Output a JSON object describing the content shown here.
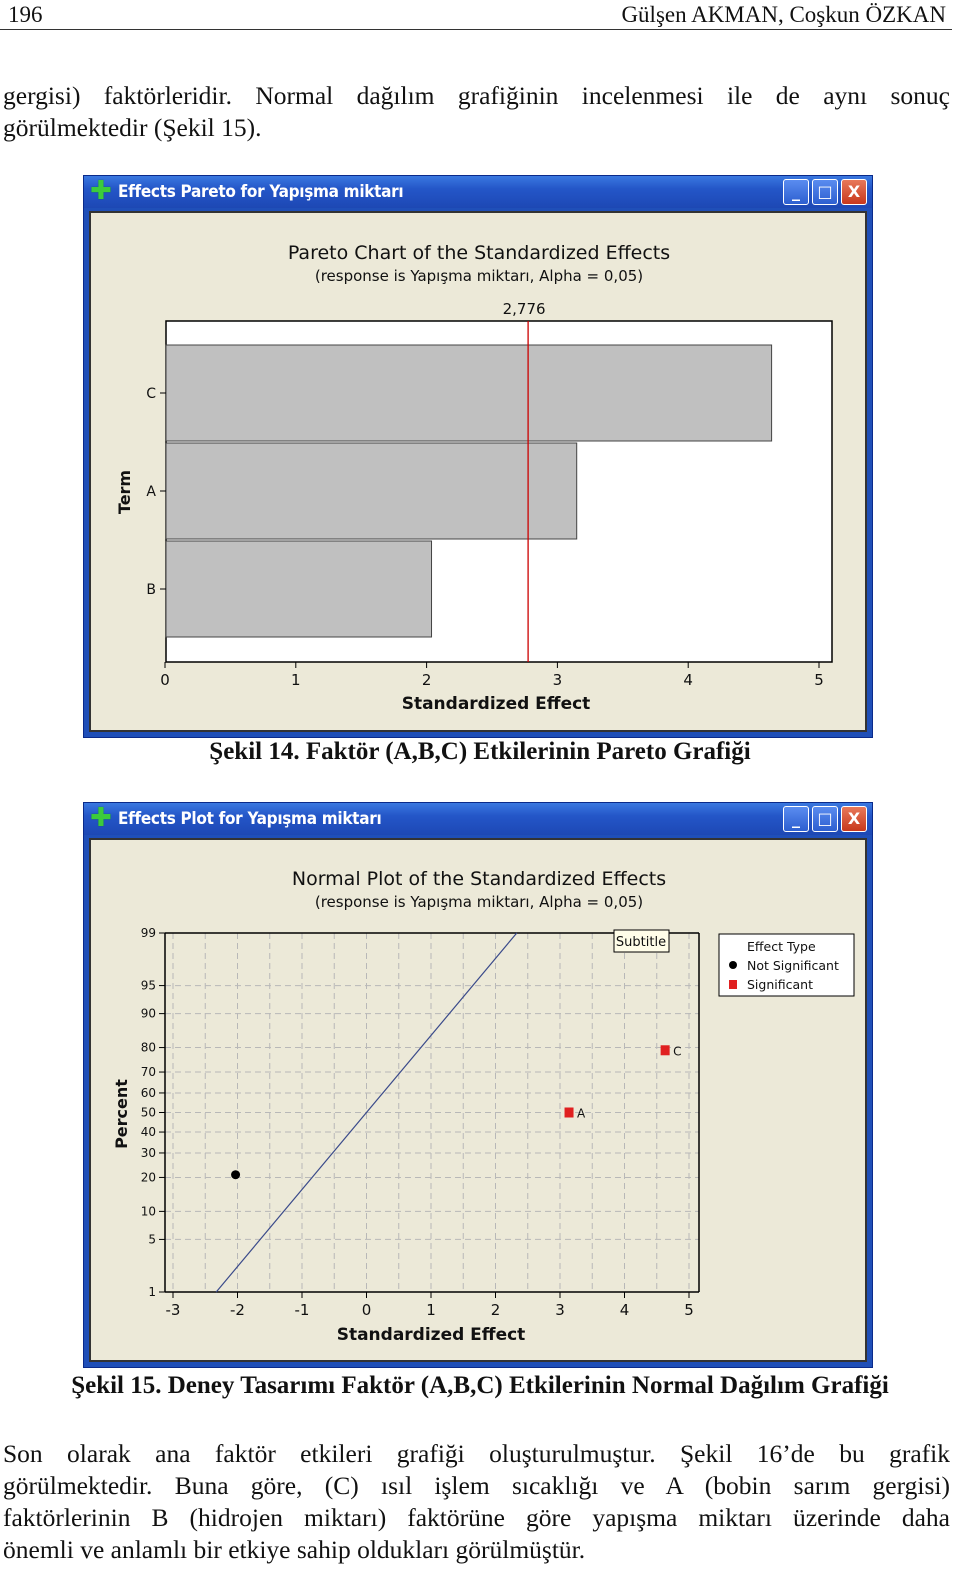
{
  "header": {
    "page_number": "196",
    "authors": "Gülşen AKMAN, Coşkun ÖZKAN"
  },
  "intro_paragraph": [
    "gergisi) faktörleridir. Normal dağılım grafiğinin incelenmesi ile de aynı sonuç",
    "görülmektedir (Şekil 15)."
  ],
  "figure14": {
    "window_title": "Effects Pareto for Yapışma miktarı",
    "caption": "Şekil 14. Faktör (A,B,C) Etkilerinin Pareto Grafiği"
  },
  "figure15": {
    "window_title": "Effects Plot for Yapışma miktarı",
    "caption": "Şekil 15. Deney Tasarımı Faktör (A,B,C) Etkilerinin Normal Dağılım Grafiği",
    "subtitle_box": "Subtitle"
  },
  "window_buttons": {
    "minimize": "_",
    "maximize": "□",
    "close": "X"
  },
  "chart_data": [
    {
      "type": "bar",
      "orientation": "horizontal",
      "title": "Pareto Chart of the Standardized Effects",
      "subtitle": "(response is Yapışma miktarı, Alpha = 0,05)",
      "xlabel": "Standardized Effect",
      "ylabel": "Term",
      "categories": [
        "C",
        "A",
        "B"
      ],
      "values": [
        4.63,
        3.14,
        2.03
      ],
      "xlim": [
        0,
        5
      ],
      "xticks": [
        "0",
        "1",
        "2",
        "3",
        "4",
        "5"
      ],
      "reference_line": {
        "value": 2.776,
        "label": "2,776",
        "color": "#cc0000"
      },
      "bar_color": "#c0c0c0",
      "grid": false
    },
    {
      "type": "scatter",
      "title": "Normal Plot of the Standardized Effects",
      "subtitle": "(response is Yapışma miktarı, Alpha = 0,05)",
      "xlabel": "Standardized Effect",
      "ylabel": "Percent",
      "xlim": [
        -3,
        5
      ],
      "xticks": [
        "-3",
        "-2",
        "-1",
        "0",
        "1",
        "2",
        "3",
        "4",
        "5"
      ],
      "yscale": "normal-probability",
      "yticks": [
        "1",
        "5",
        "10",
        "20",
        "30",
        "40",
        "50",
        "60",
        "70",
        "80",
        "90",
        "95",
        "99"
      ],
      "grid": true,
      "legend": {
        "title": "Effect Type",
        "position": "right",
        "entries": [
          {
            "label": "Not Significant",
            "marker": "circle",
            "color": "#000000"
          },
          {
            "label": "Significant",
            "marker": "square",
            "color": "#e02020"
          }
        ]
      },
      "points": [
        {
          "label": "",
          "x": -2.03,
          "y": 21,
          "type": "Not Significant"
        },
        {
          "label": "A",
          "x": 3.14,
          "y": 50,
          "type": "Significant"
        },
        {
          "label": "C",
          "x": 4.63,
          "y": 79,
          "type": "Significant"
        }
      ],
      "fit_line": {
        "x_at_1pct": -2.33,
        "x_at_50pct": 0,
        "x_at_99pct": 2.33,
        "color": "#3a4a8a"
      }
    }
  ],
  "closing_paragraph": [
    "Son olarak ana faktör etkileri grafiği oluşturulmuştur. Şekil 16’de bu grafik",
    "görülmektedir. Buna göre, (C) ısıl işlem sıcaklığı ve A (bobin sarım gergisi)",
    "faktörlerinin B (hidrojen miktarı) faktörüne göre yapışma miktarı üzerinde daha",
    "önemli ve anlamlı bir etkiye sahip oldukları görülmüştür."
  ]
}
